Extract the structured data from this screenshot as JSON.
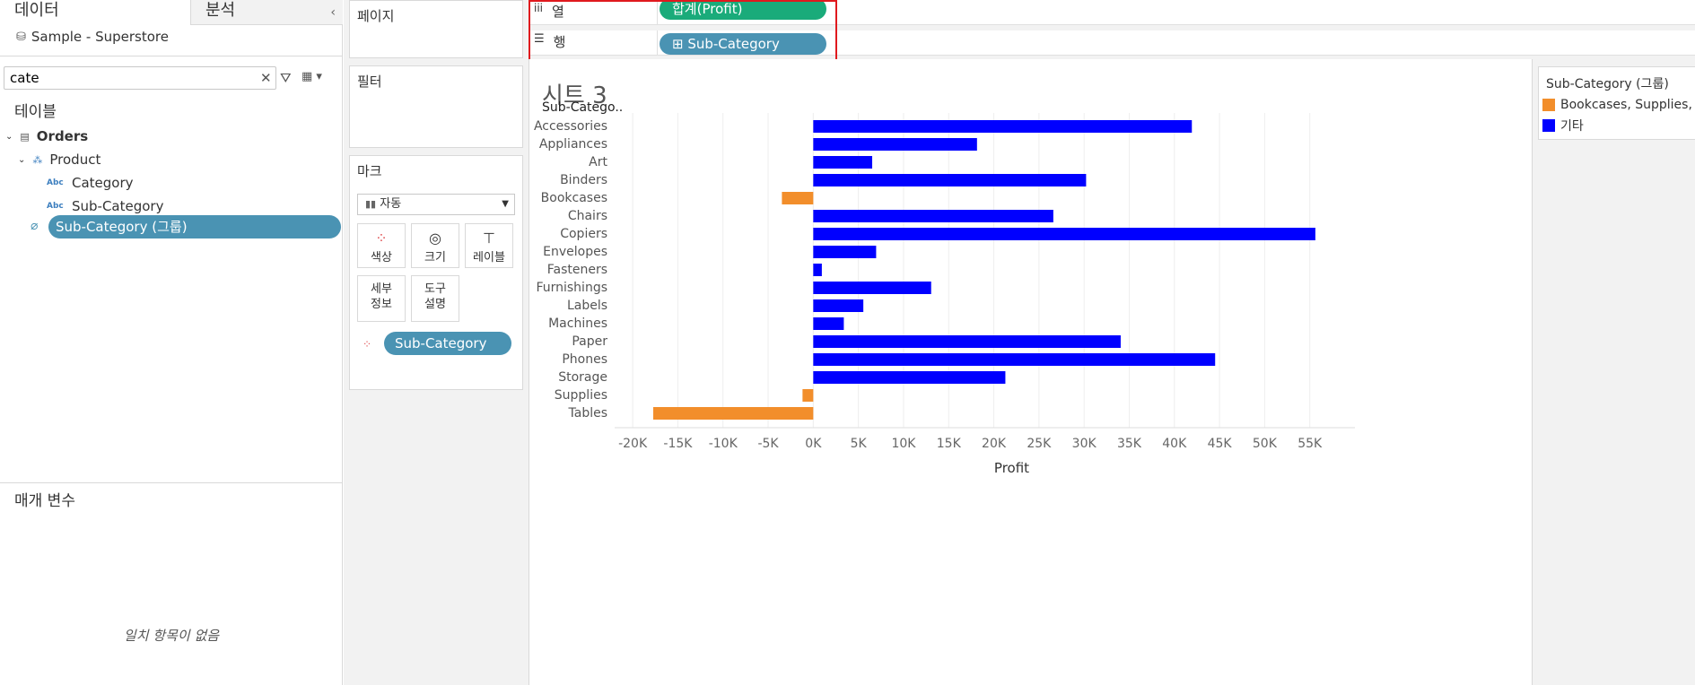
{
  "tabs": {
    "data": "데이터",
    "analysis": "분석"
  },
  "datasource": "Sample - Superstore",
  "search": {
    "value": "cate"
  },
  "sections": {
    "tables": "테이블",
    "parameters": "매개 변수",
    "no_match": "일치 항목이 없음"
  },
  "tree": {
    "orders": "Orders",
    "product": "Product",
    "fields": [
      "Category",
      "Sub-Category"
    ],
    "abc": "Abc",
    "group_field": "Sub-Category (그룹)"
  },
  "cards": {
    "pages": "페이지",
    "filters": "필터",
    "marks": "마크"
  },
  "marks": {
    "type": "자동",
    "buttons": [
      "색상",
      "크기",
      "레이블"
    ],
    "buttons2": [
      [
        "세부",
        "정보"
      ],
      [
        "도구",
        "설명"
      ]
    ],
    "color_pill": "Sub-Category (.."
  },
  "shelves": {
    "columns_label": "열",
    "rows_label": "행",
    "columns_pill": "합계(Profit)",
    "rows_pill": "⊞ Sub-Category"
  },
  "sheet_title": "시트 3",
  "colors": {
    "orange": "#f28e2b",
    "blue": "#0000ff",
    "highlight": "#e0191e"
  },
  "legend": {
    "title": "Sub-Category (그룹)",
    "items": [
      {
        "label": "Bookcases, Supplies, Tables",
        "color": "#f28e2b"
      },
      {
        "label": "기타",
        "color": "#0000ff"
      }
    ]
  },
  "chart_data": {
    "type": "bar",
    "orientation": "horizontal",
    "row_header": "Sub-Catego..",
    "xlabel": "Profit",
    "xlim": [
      -22000,
      60000
    ],
    "xticks": [
      -20000,
      -15000,
      -10000,
      -5000,
      0,
      5000,
      10000,
      15000,
      20000,
      25000,
      30000,
      35000,
      40000,
      45000,
      50000,
      55000
    ],
    "xtick_labels": [
      "-20K",
      "-15K",
      "-10K",
      "-5K",
      "0K",
      "5K",
      "10K",
      "15K",
      "20K",
      "25K",
      "30K",
      "35K",
      "40K",
      "45K",
      "50K",
      "55K"
    ],
    "categories": [
      "Accessories",
      "Appliances",
      "Art",
      "Binders",
      "Bookcases",
      "Chairs",
      "Copiers",
      "Envelopes",
      "Fasteners",
      "Furnishings",
      "Labels",
      "Machines",
      "Paper",
      "Phones",
      "Storage",
      "Supplies",
      "Tables"
    ],
    "values": [
      41937,
      18138,
      6528,
      30222,
      -3473,
      26590,
      55618,
      6964,
      950,
      13059,
      5546,
      3385,
      34054,
      44516,
      21279,
      -1189,
      -17725
    ],
    "groups": [
      "기타",
      "기타",
      "기타",
      "기타",
      "Bookcases, Supplies, Tables",
      "기타",
      "기타",
      "기타",
      "기타",
      "기타",
      "기타",
      "기타",
      "기타",
      "기타",
      "기타",
      "Bookcases, Supplies, Tables",
      "Bookcases, Supplies, Tables"
    ],
    "grid": "vertical"
  }
}
